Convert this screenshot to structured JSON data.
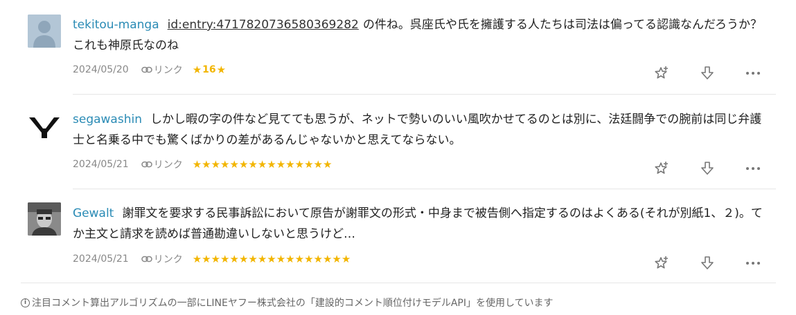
{
  "comments": [
    {
      "user": "tekitou-manga",
      "entry_link": "id:entry:4717820736580369282",
      "text": "の件ね。呉座氏や氏を擁護する人たちは司法は偏ってる認識なんだろうか？これも神原氏なのね",
      "date": "2024/05/20",
      "link_label": "リンク",
      "star_count": "16",
      "avatar_icon": "default-user-icon"
    },
    {
      "user": "segawashin",
      "text": "しかし暇の字の件など見てても思うが、ネットで勢いのいい風吹かせてるのとは別に、法廷闘争での腕前は同じ弁護士と名乗る中でも驚くばかりの差があるんじゃないかと思えてならない。",
      "date": "2024/05/21",
      "link_label": "リンク",
      "stars": "★★★★★★★★★★★★★★★",
      "avatar_icon": "yy-logo-icon"
    },
    {
      "user": "Gewalt",
      "text": "謝罪文を要求する民事訴訟において原告が謝罪文の形式・中身まで被告側へ指定するのはよくある(それが別紙1、２)。てか主文と請求を読めば普通勘違いしないと思うけど…",
      "date": "2024/05/21",
      "link_label": "リンク",
      "stars": "★★★★★★★★★★★★★★★★★",
      "avatar_icon": "person-photo-icon"
    }
  ],
  "footer": {
    "text": "注目コメント算出アルゴリズムの一部にLINEヤフー株式会社の「建設的コメント順位付けモデルAPI」を使用しています"
  },
  "colors": {
    "username": "#2a8bb5",
    "star": "#f2b500",
    "meta": "#888888"
  }
}
